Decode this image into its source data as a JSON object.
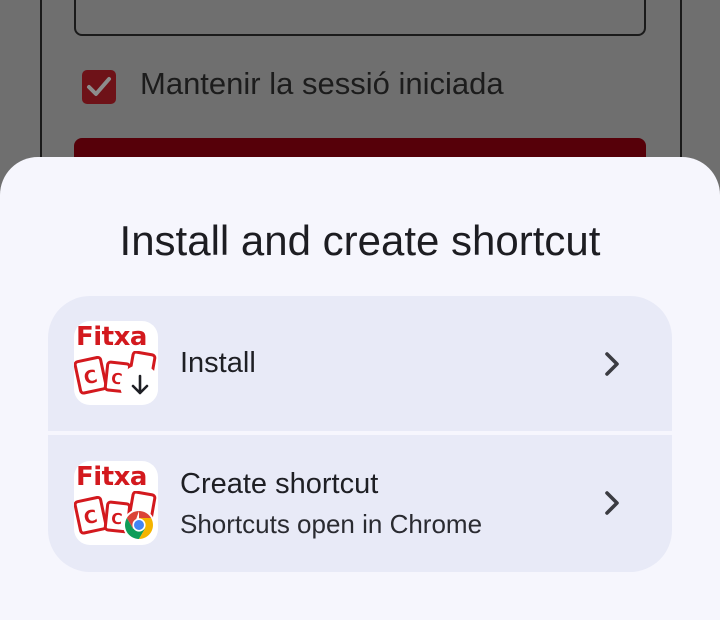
{
  "background": {
    "remember_label": "Mantenir la sessió iniciada",
    "remember_checked": true,
    "accent_color": "#6e1218"
  },
  "sheet": {
    "title": "Install and create shortcut",
    "options": [
      {
        "label": "Install",
        "icon": "fitxa-app-icon",
        "badge": "download-icon"
      },
      {
        "label": "Create shortcut",
        "sublabel": "Shortcuts open in Chrome",
        "icon": "fitxa-app-icon",
        "badge": "chrome-icon"
      }
    ]
  },
  "app_icon": {
    "brand_text": "Fitxa",
    "brand_color": "#d3191e"
  }
}
